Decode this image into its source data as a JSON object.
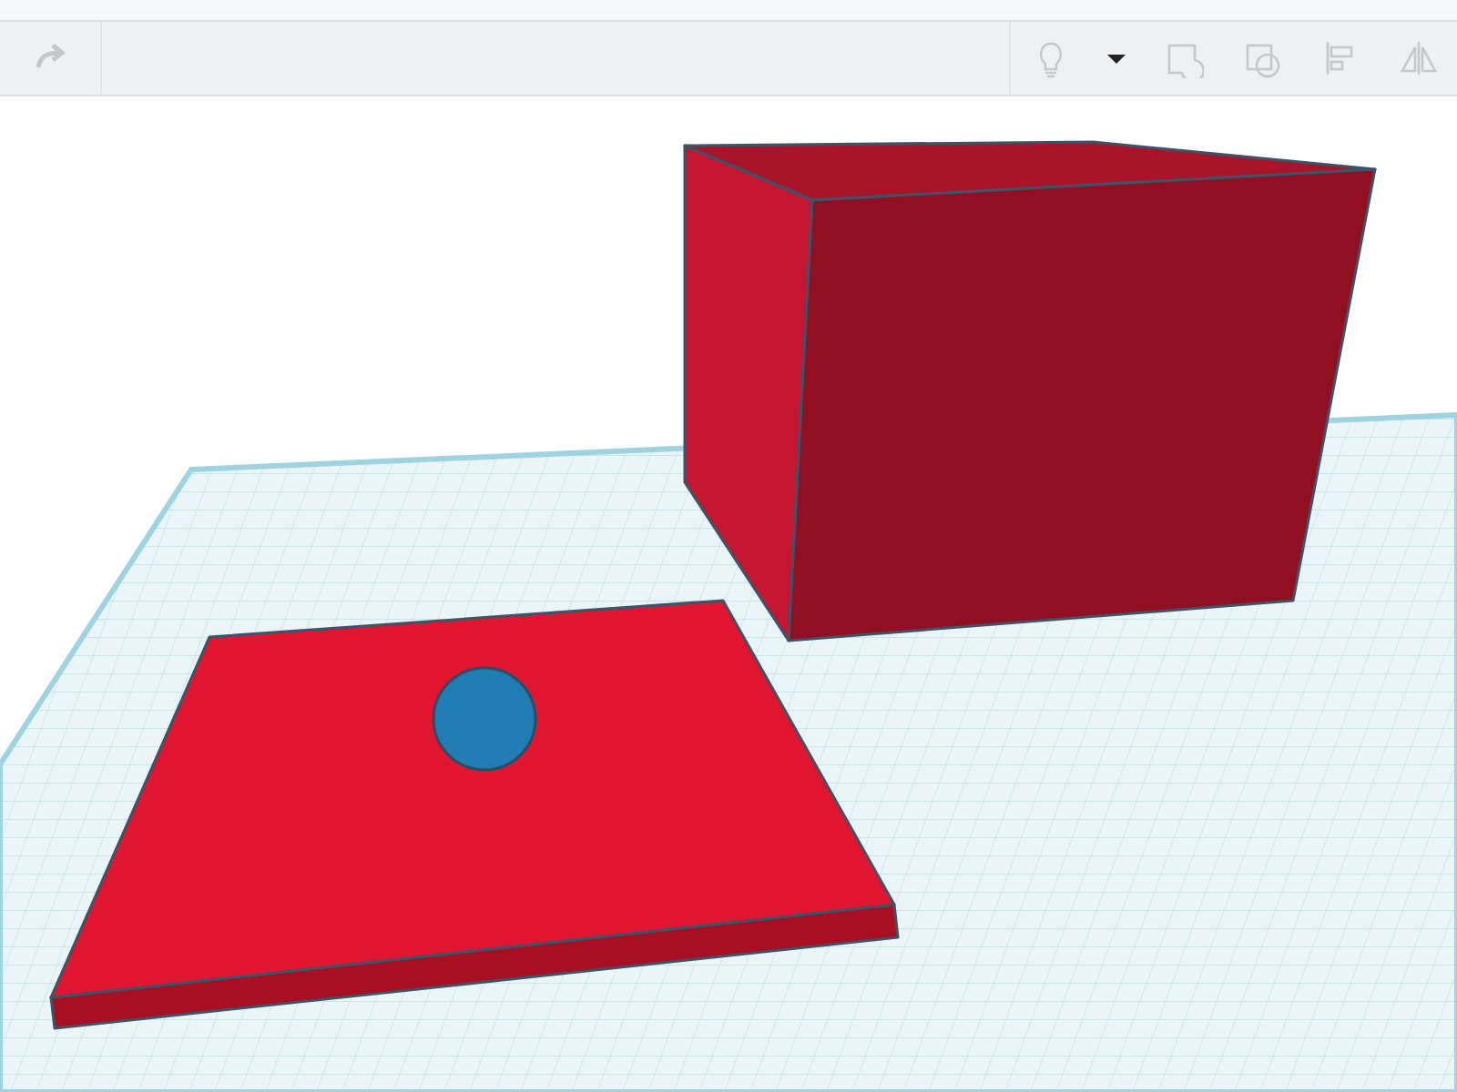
{
  "toolbar": {
    "left": [
      {
        "kind": "redo",
        "disabled": true
      }
    ],
    "right": [
      {
        "kind": "bulb",
        "disabled": true
      },
      {
        "kind": "caret",
        "disabled": false
      },
      {
        "kind": "group",
        "disabled": true
      },
      {
        "kind": "ungroup",
        "disabled": true
      },
      {
        "kind": "align",
        "disabled": true
      },
      {
        "kind": "mirror",
        "disabled": true
      }
    ]
  }
}
